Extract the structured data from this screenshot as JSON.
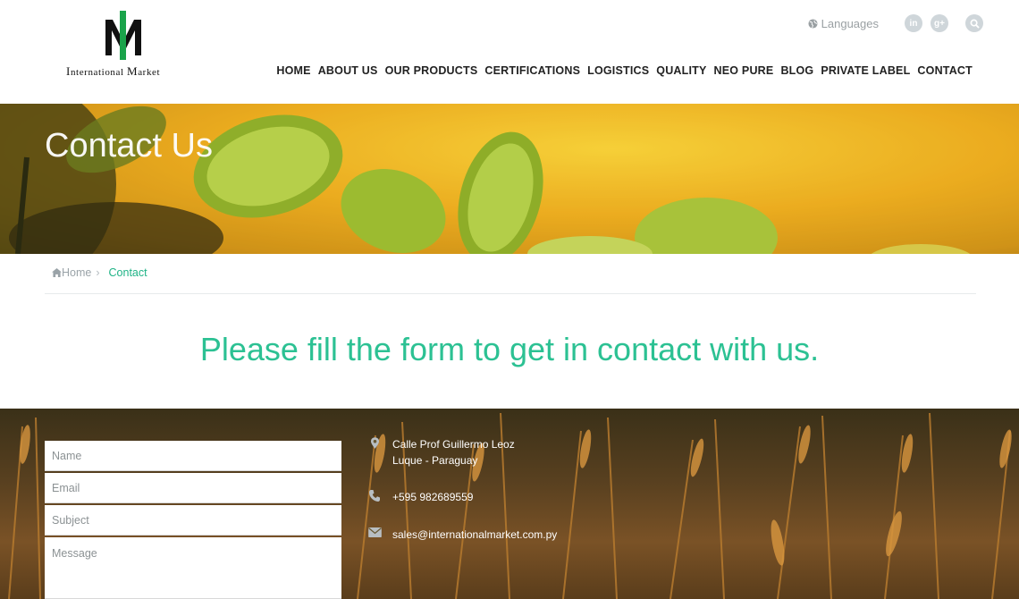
{
  "brand": {
    "logo_text_1": "I",
    "logo_text_2": "nternational ",
    "logo_text_3": "M",
    "logo_text_4": "arket",
    "colors": {
      "green": "#1aa34a",
      "dark": "#111111",
      "accent": "#2cc193"
    }
  },
  "top_tools": {
    "languages_label": "Languages",
    "icons": [
      "globe-icon",
      "linkedin-icon",
      "google-plus-icon",
      "search-icon"
    ],
    "linkedin_glyph": "in",
    "googleplus_glyph": "g+"
  },
  "nav": {
    "items": [
      {
        "label": "HOME"
      },
      {
        "label": "ABOUT US"
      },
      {
        "label": "OUR PRODUCTS"
      },
      {
        "label": "CERTIFICATIONS"
      },
      {
        "label": "LOGISTICS"
      },
      {
        "label": "QUALITY"
      },
      {
        "label": "NEO PURE"
      },
      {
        "label": "BLOG"
      },
      {
        "label": "PRIVATE LABEL"
      },
      {
        "label": "CONTACT"
      }
    ]
  },
  "banner": {
    "title": "Contact Us"
  },
  "breadcrumb": {
    "home": "Home",
    "separator": "›",
    "current": "Contact"
  },
  "headline": "Please fill the form to get in contact with us.",
  "form": {
    "name_placeholder": "Name",
    "email_placeholder": "Email",
    "subject_placeholder": "Subject",
    "message_placeholder": "Message"
  },
  "contact": {
    "address_line1": "Calle Prof Guillermo Leoz",
    "address_line2": "Luque - Paraguay",
    "phone": "+595 982689559",
    "email": "sales@internationalmarket.com.py"
  }
}
